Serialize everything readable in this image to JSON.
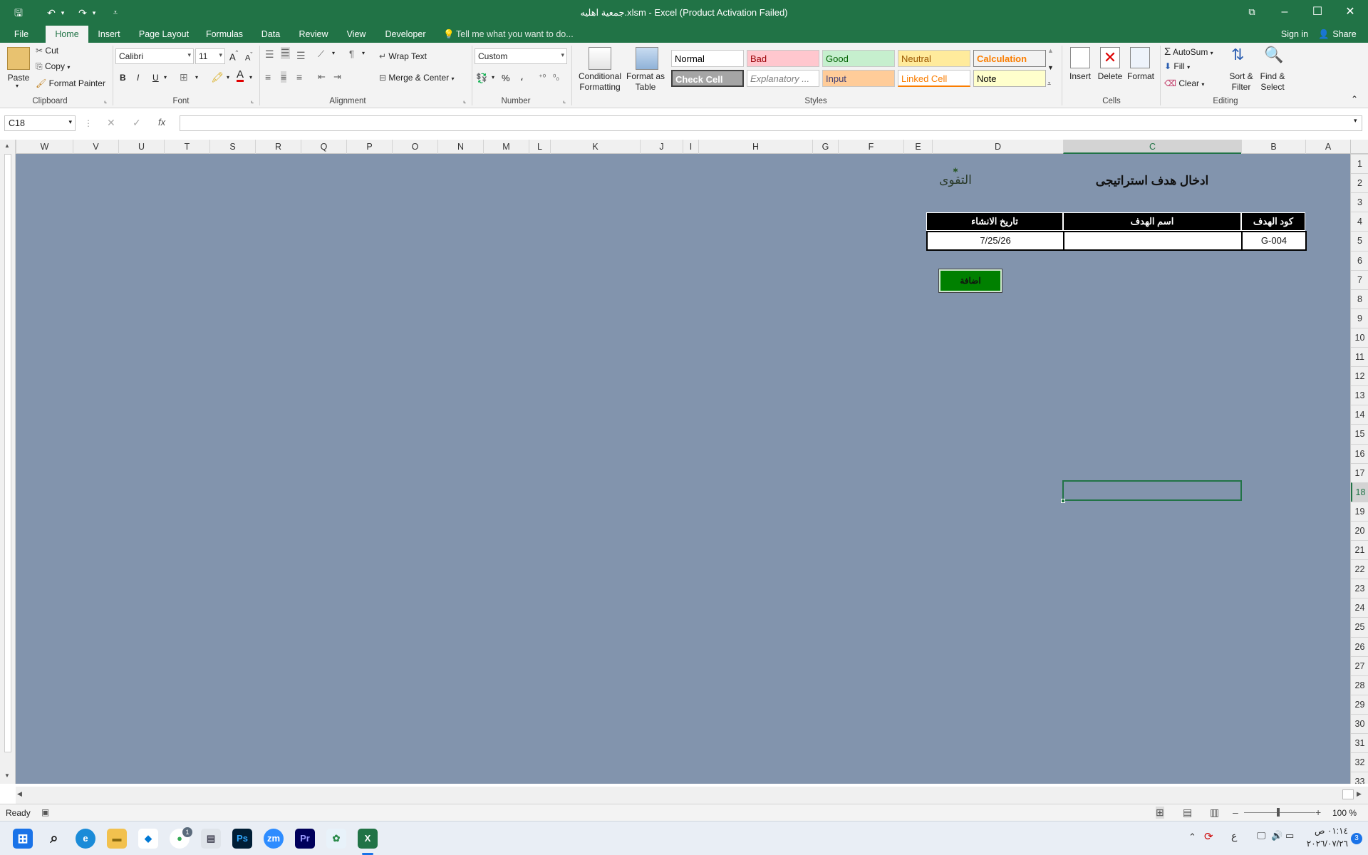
{
  "window": {
    "title": "جمعية اهليه.xlsm - Excel (Product Activation Failed)",
    "signin": "Sign in",
    "share": "Share"
  },
  "tabs": [
    "File",
    "Home",
    "Insert",
    "Page Layout",
    "Formulas",
    "Data",
    "Review",
    "View",
    "Developer"
  ],
  "tell_me": "Tell me what you want to do...",
  "ribbon": {
    "clipboard": {
      "paste": "Paste",
      "cut": "Cut",
      "copy": "Copy",
      "format_painter": "Format Painter",
      "label": "Clipboard"
    },
    "font": {
      "name": "Calibri",
      "size": "11",
      "bold": "B",
      "italic": "I",
      "underline": "U",
      "label": "Font"
    },
    "alignment": {
      "wrap": "Wrap Text",
      "merge": "Merge & Center",
      "label": "Alignment"
    },
    "number": {
      "format": "Custom",
      "percent": "%",
      "comma": "،",
      "label": "Number"
    },
    "styles": {
      "conditional": "Conditional Formatting",
      "format_table": "Format as Table",
      "cells": [
        {
          "text": "Normal",
          "bg": "#ffffff",
          "fg": "#000000"
        },
        {
          "text": "Bad",
          "bg": "#ffc7ce",
          "fg": "#9c0006"
        },
        {
          "text": "Good",
          "bg": "#c6efce",
          "fg": "#006100"
        },
        {
          "text": "Neutral",
          "bg": "#ffeb9c",
          "fg": "#9c5700"
        },
        {
          "text": "Calculation",
          "bg": "#f2f2f2",
          "fg": "#fa7d00"
        },
        {
          "text": "Check Cell",
          "bg": "#a5a5a5",
          "fg": "#ffffff"
        },
        {
          "text": "Explanatory ...",
          "bg": "#ffffff",
          "fg": "#7f7f7f"
        },
        {
          "text": "Input",
          "bg": "#ffcc99",
          "fg": "#3f3f76"
        },
        {
          "text": "Linked Cell",
          "bg": "#ffffff",
          "fg": "#fa7d00"
        },
        {
          "text": "Note",
          "bg": "#ffffcc",
          "fg": "#000000"
        }
      ],
      "label": "Styles"
    },
    "cells": {
      "insert": "Insert",
      "delete": "Delete",
      "format": "Format",
      "label": "Cells"
    },
    "editing": {
      "autosum": "AutoSum",
      "fill": "Fill",
      "clear": "Clear",
      "sort": "Sort & Filter",
      "find": "Find & Select",
      "label": "Editing"
    }
  },
  "formula_bar": {
    "name_box": "C18",
    "fx": "fx",
    "value": ""
  },
  "columns": [
    "W",
    "V",
    "U",
    "T",
    "S",
    "R",
    "Q",
    "P",
    "O",
    "N",
    "M",
    "L",
    "K",
    "J",
    "I",
    "H",
    "G",
    "F",
    "E",
    "D",
    "C",
    "B",
    "A"
  ],
  "rows": [
    "1",
    "2",
    "3",
    "4",
    "5",
    "6",
    "7",
    "8",
    "9",
    "10",
    "11",
    "12",
    "13",
    "14",
    "15",
    "16",
    "17",
    "18",
    "19",
    "20",
    "21",
    "22",
    "23",
    "24",
    "25",
    "26",
    "27",
    "28",
    "29",
    "30",
    "31",
    "32",
    "33"
  ],
  "form": {
    "title": "ادخال هدف استراتيجى",
    "logo_text": "التقوى",
    "headers": {
      "date": "تاريخ الانشاء",
      "name": "اسم الهدف",
      "code": "كود الهدف"
    },
    "values": {
      "date": "7/25/26",
      "name": "",
      "code": "G-004"
    },
    "add_button": "اضافة"
  },
  "status": {
    "ready": "Ready",
    "zoom": "100 %"
  },
  "taskbar": {
    "clock_time": "٠١:١٤ ص",
    "clock_date": "٢٠٢٦/٠٧/٢٦",
    "lang": "ع",
    "notifications": "3",
    "chrome_badge": "1",
    "apps": [
      {
        "name": "start",
        "label": "⊞"
      },
      {
        "name": "search",
        "label": "⌕"
      },
      {
        "name": "edge",
        "label": "e"
      },
      {
        "name": "explorer",
        "label": "▬"
      },
      {
        "name": "vscode",
        "label": "◆"
      },
      {
        "name": "chrome",
        "label": "●"
      },
      {
        "name": "printer",
        "label": "▤"
      },
      {
        "name": "photoshop",
        "label": "Ps"
      },
      {
        "name": "zoom",
        "label": "zm"
      },
      {
        "name": "premiere",
        "label": "Pr"
      },
      {
        "name": "paint",
        "label": "✿"
      },
      {
        "name": "excel",
        "label": "X"
      }
    ]
  },
  "colors": {
    "excel_green": "#217346",
    "sheet_bg": "#8294ad",
    "add_button": "#008000"
  }
}
